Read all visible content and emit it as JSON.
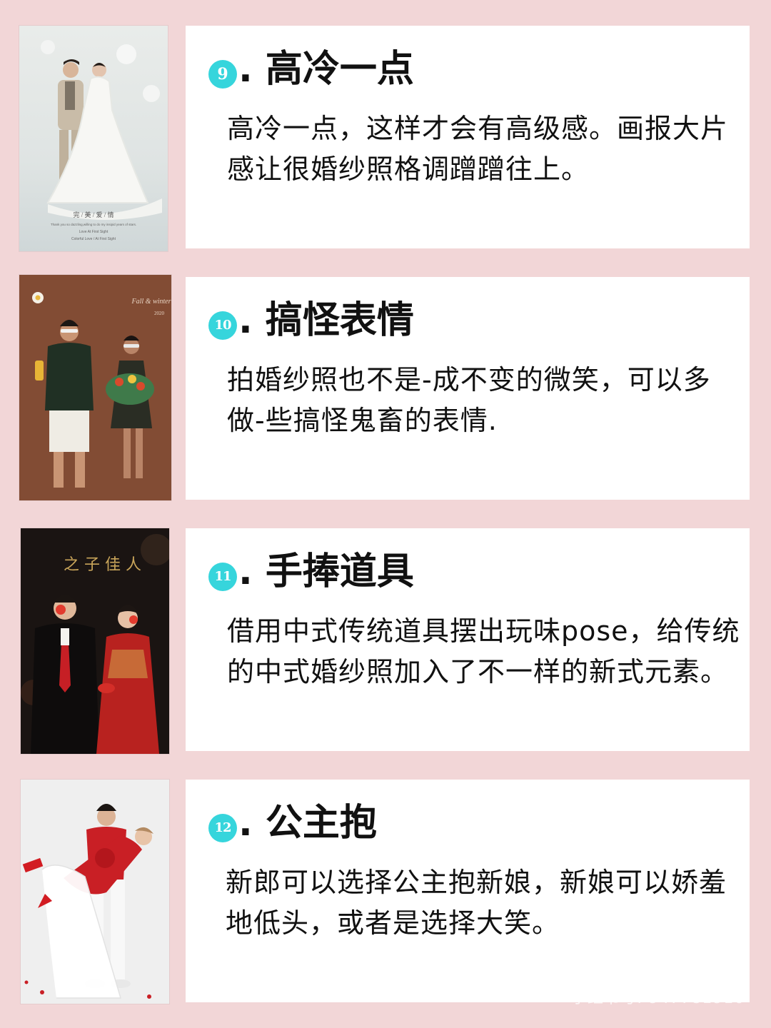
{
  "items": [
    {
      "number": "9",
      "title": ". 高冷一点",
      "description": "高冷一点，这样才会有高级感。画报大片感让很婚纱照格调蹭蹭往上。",
      "photo": {
        "caption_title": "完 / 美 / 爱 / 情",
        "caption_line1": "Thank you so dazzling,willing to do my insipid years of stars.",
        "caption_line2": "Love At First Sight",
        "caption_line3": "Colorful Love / At First Sight"
      }
    },
    {
      "number": "10",
      "title": ". 搞怪表情",
      "description": "拍婚纱照也不是-成不变的微笑，可以多做-些搞怪鬼畜的表情.",
      "photo": {
        "caption_year": "2020",
        "caption_script": "Fall & winter"
      }
    },
    {
      "number": "11",
      "title": ". 手捧道具",
      "description": "借用中式传统道具摆出玩味pose，给传统的中式婚纱照加入了不一样的新式元素。",
      "photo": {
        "caption_calligraphy": "之 子 佳 人"
      }
    },
    {
      "number": "12",
      "title": ". 公主抱",
      "description": "新郎可以选择公主抱新娘，新娘可以娇羞地低头，或者是选择大笑。",
      "photo": {}
    }
  ],
  "watermark": {
    "logo": "小红书",
    "id_text": "小红书号: 947781910"
  }
}
